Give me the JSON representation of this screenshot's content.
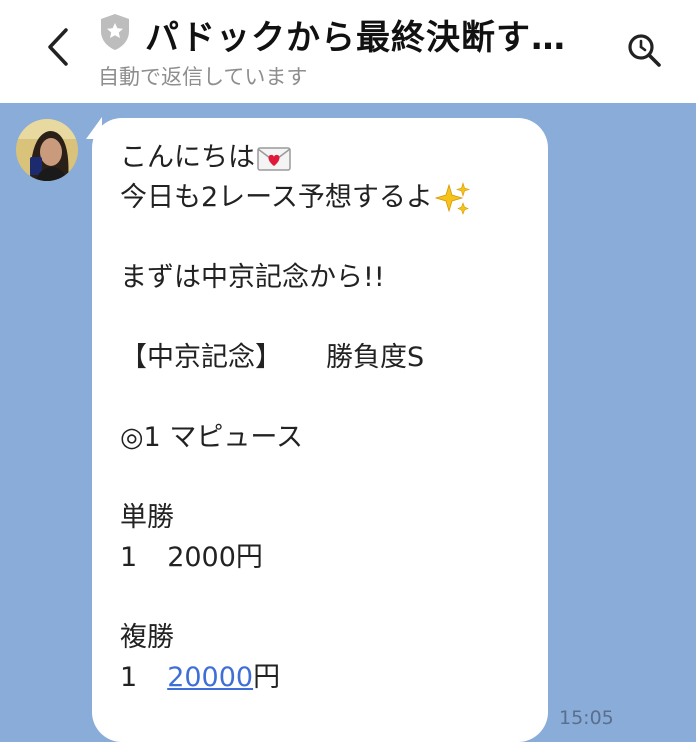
{
  "header": {
    "title": "パドックから最終決断す…",
    "subtitle": "自動で返信しています",
    "icons": [
      "back-arrow-icon",
      "shield-icon",
      "search-icon"
    ]
  },
  "message": {
    "greeting": "こんにちは",
    "line2": "今日も2レース予想するよ",
    "line3": "まずは中京記念から!!",
    "race_name": "【中京記念】",
    "confidence": "勝負度S",
    "pick": "◎1 マピュース",
    "win_label": "単勝",
    "win_num": "1",
    "win_amount": "2000円",
    "place_label": "複勝",
    "place_num": "1",
    "place_amount_link": "20000",
    "place_amount_unit": "円",
    "time": "15:05",
    "emojis": [
      "love-letter-icon",
      "sparkles-icon"
    ]
  },
  "colors": {
    "chat_background": "#8aacd9",
    "bubble": "#ffffff",
    "link": "#3f6fd6"
  }
}
